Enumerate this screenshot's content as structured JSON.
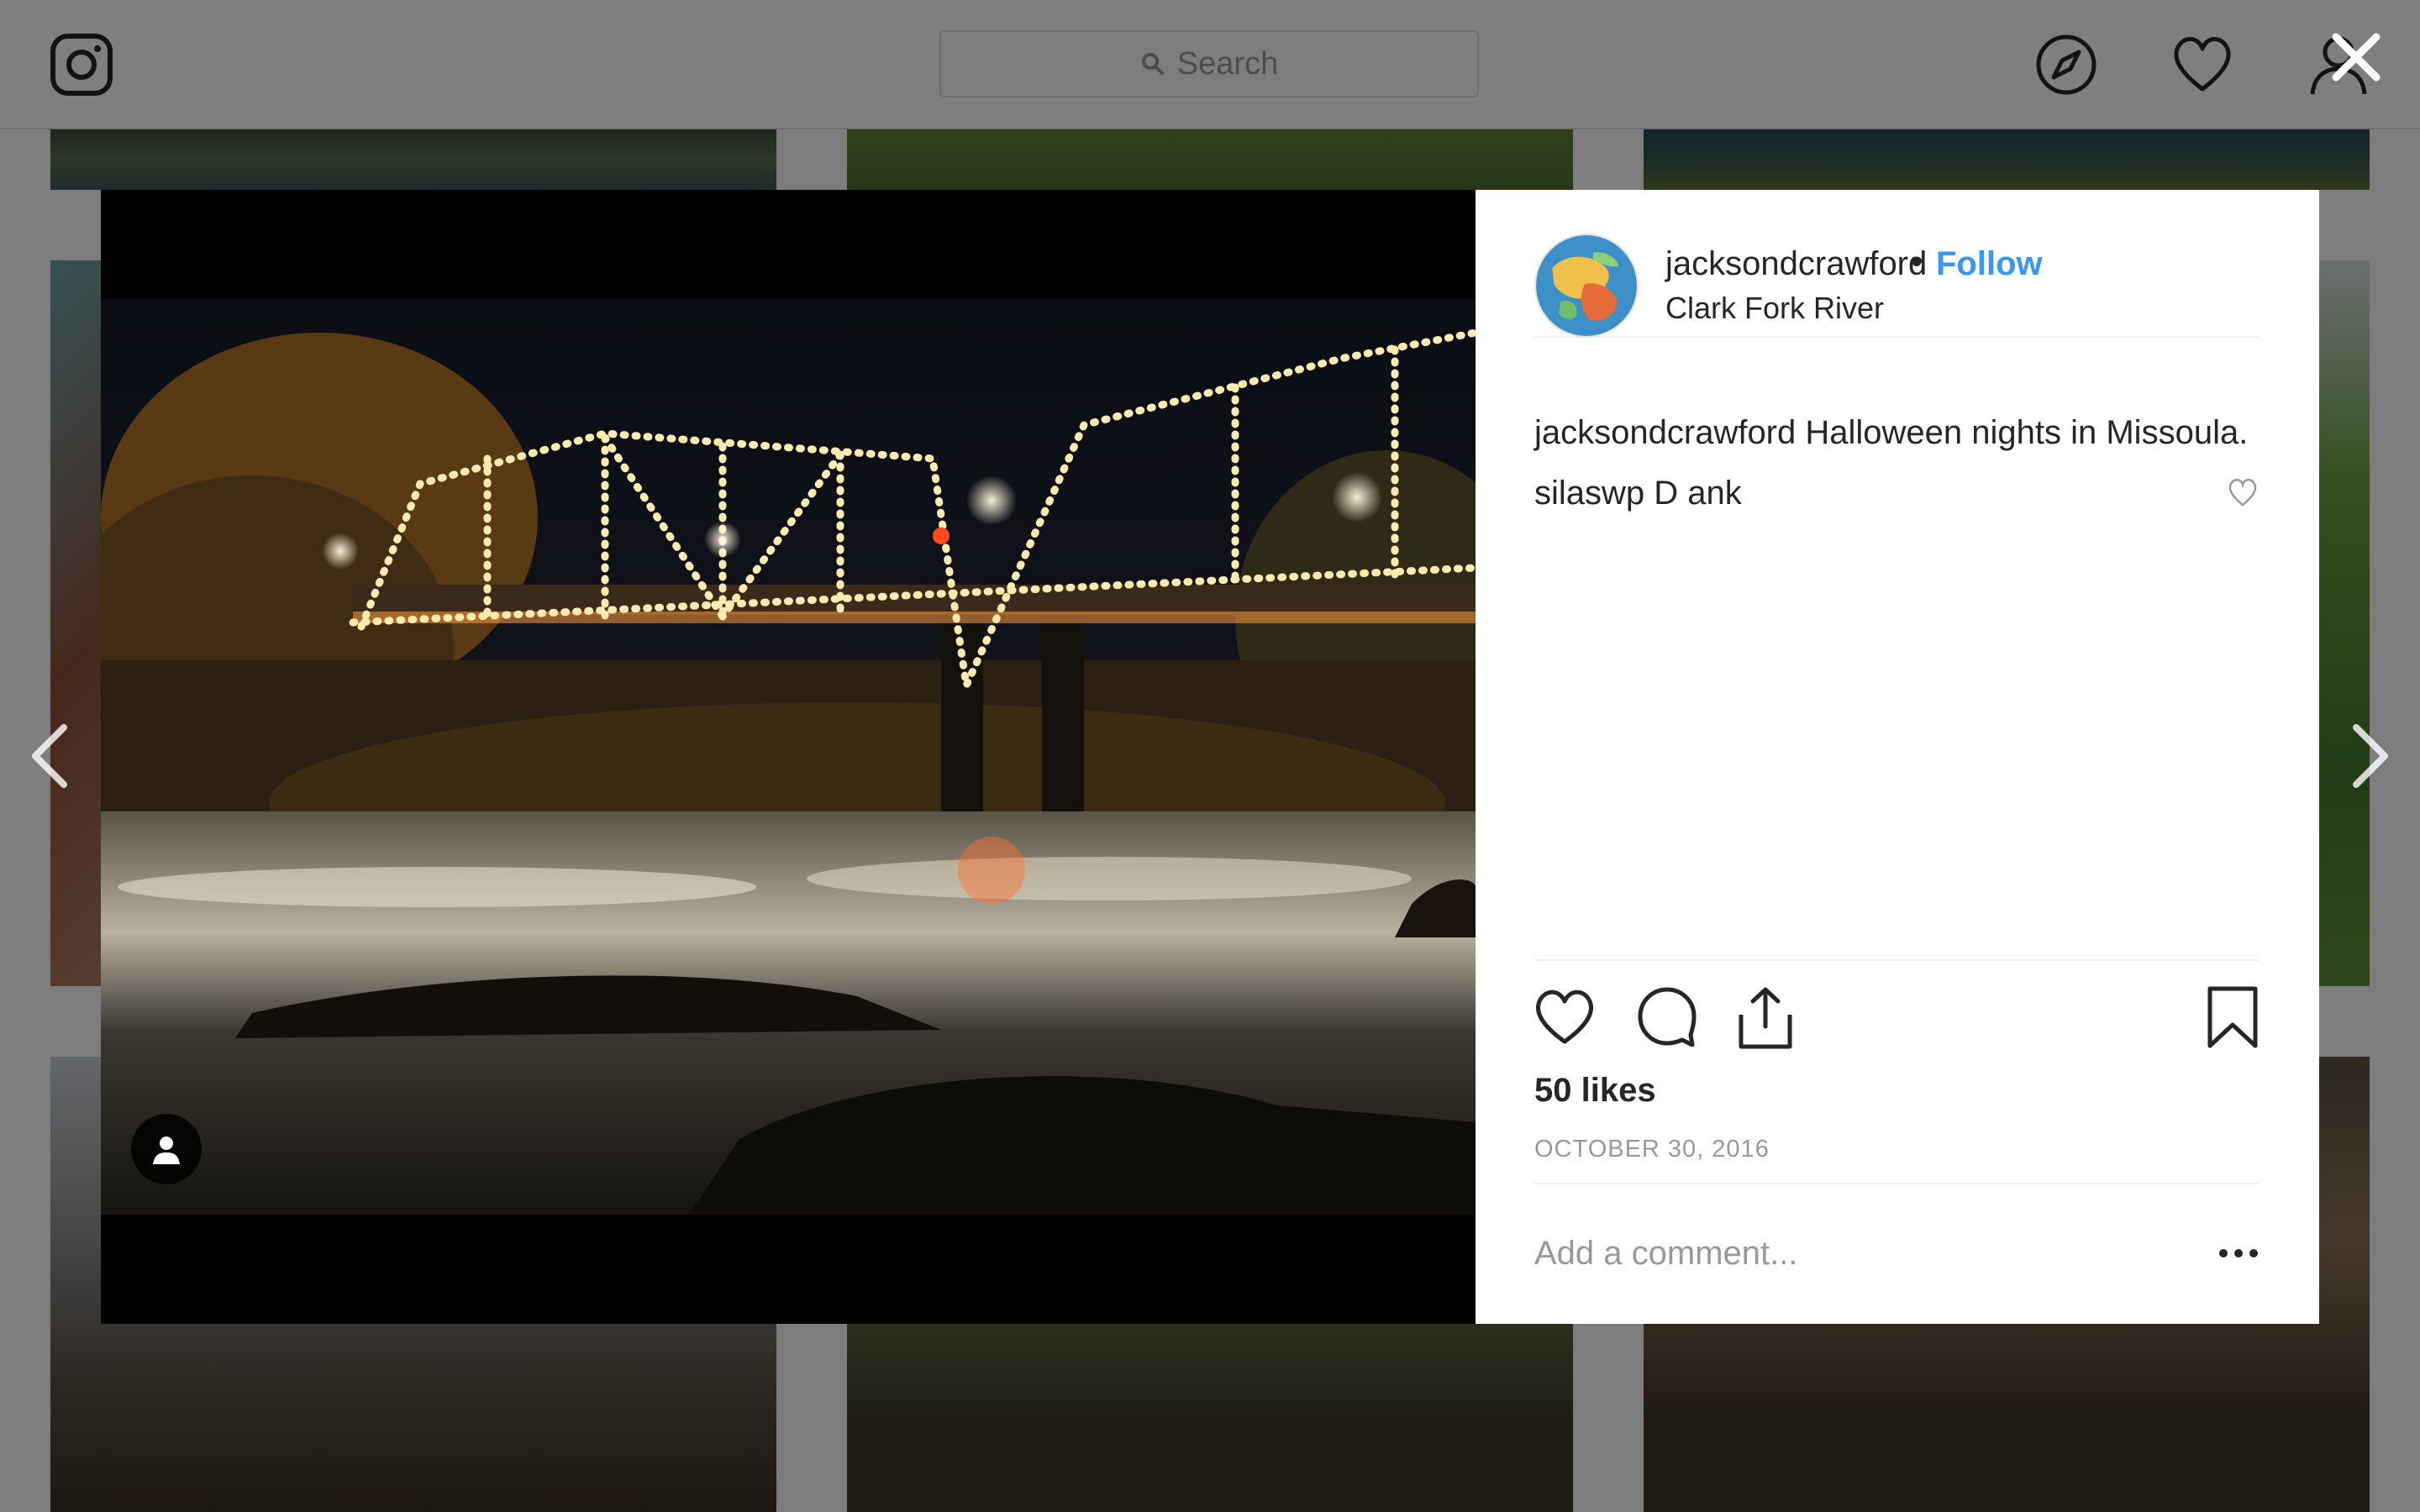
{
  "search": {
    "placeholder": "Search"
  },
  "modal": {
    "header": {
      "username": "jacksondcrawford",
      "separator": "•",
      "follow_label": "Follow",
      "location": "Clark Fork River"
    },
    "comments": [
      {
        "username": "jacksondcrawford",
        "text": "Halloween nights in Missoula."
      },
      {
        "username": "silaswp",
        "text": "D ank"
      }
    ],
    "likes": "50 likes",
    "date": "OCTOBER 30, 2016",
    "comment_input": {
      "placeholder": "Add a comment..."
    }
  },
  "icons": {
    "logo": "instagram-logo-icon",
    "search": "search-icon",
    "explore": "compass-icon",
    "activity": "heart-icon",
    "profile": "user-icon",
    "close": "close-icon",
    "prev": "chevron-left-icon",
    "next": "chevron-right-icon",
    "like": "heart-outline-icon",
    "comment": "speech-bubble-icon",
    "share": "share-icon",
    "save": "bookmark-icon",
    "more": "more-horizontal-icon",
    "user_tag": "person-icon"
  },
  "colors": {
    "accent": "#3897f0",
    "text": "#262626",
    "muted": "#999999",
    "divider": "#efefef"
  }
}
